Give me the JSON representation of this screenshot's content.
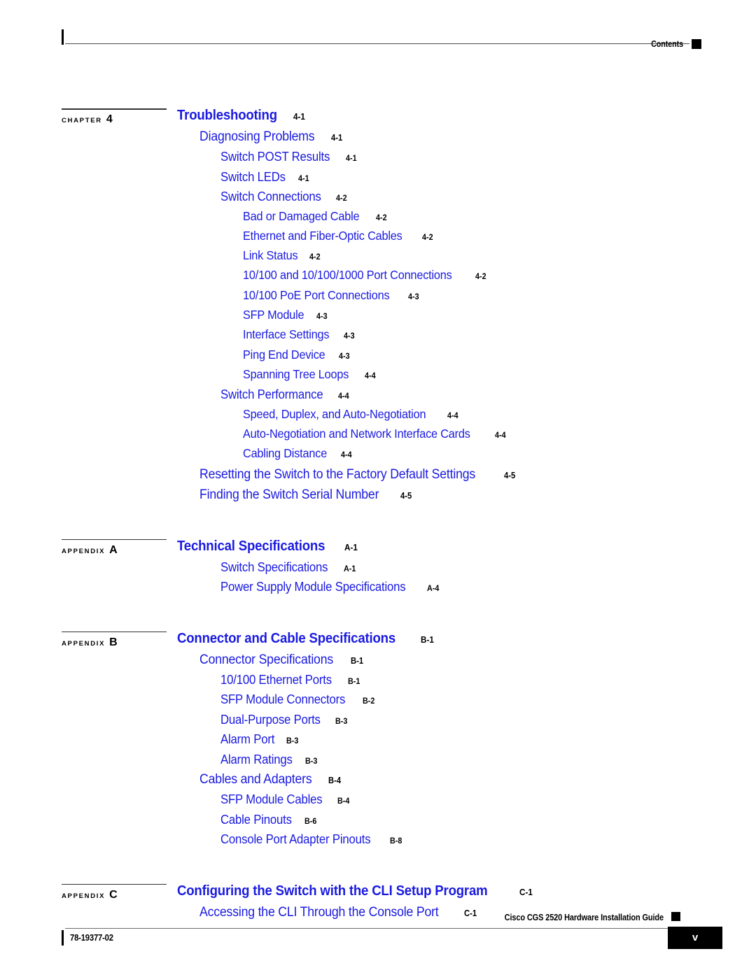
{
  "header": {
    "label": "Contents",
    "marker_icon": "black-square-marker"
  },
  "footer": {
    "guide_title": "Cisco CGS 2520 Hardware Installation Guide",
    "doc_number": "78-19377-02",
    "page_number": "v",
    "marker_icon": "black-square-marker"
  },
  "colors": {
    "entry_link": "#1a1ae0",
    "page_number": "#000000",
    "rule": "#4d4d4d"
  },
  "groups": [
    {
      "marker_word": "CHAPTER",
      "marker_num": "4",
      "entries": [
        {
          "level": 0,
          "title": "Troubleshooting",
          "page": "4-1"
        },
        {
          "level": 1,
          "title": "Diagnosing Problems",
          "page": "4-1"
        },
        {
          "level": 2,
          "title": "Switch POST Results",
          "page": "4-1"
        },
        {
          "level": 2,
          "title": "Switch LEDs",
          "page": "4-1"
        },
        {
          "level": 2,
          "title": "Switch Connections",
          "page": "4-2"
        },
        {
          "level": 3,
          "title": "Bad or Damaged Cable",
          "page": "4-2"
        },
        {
          "level": 3,
          "title": "Ethernet and Fiber-Optic Cables",
          "page": "4-2"
        },
        {
          "level": 3,
          "title": "Link Status",
          "page": "4-2"
        },
        {
          "level": 3,
          "title": "10/100 and 10/100/1000 Port Connections",
          "page": "4-2"
        },
        {
          "level": 3,
          "title": "10/100 PoE Port Connections",
          "page": "4-3"
        },
        {
          "level": 3,
          "title": "SFP Module",
          "page": "4-3"
        },
        {
          "level": 3,
          "title": "Interface Settings",
          "page": "4-3"
        },
        {
          "level": 3,
          "title": "Ping End Device",
          "page": "4-3"
        },
        {
          "level": 3,
          "title": "Spanning Tree Loops",
          "page": "4-4"
        },
        {
          "level": 2,
          "title": "Switch Performance",
          "page": "4-4"
        },
        {
          "level": 3,
          "title": "Speed, Duplex, and Auto-Negotiation",
          "page": "4-4"
        },
        {
          "level": 3,
          "title": "Auto-Negotiation and Network Interface Cards",
          "page": "4-4"
        },
        {
          "level": 3,
          "title": "Cabling Distance",
          "page": "4-4"
        },
        {
          "level": 1,
          "title": "Resetting the Switch to the Factory Default Settings",
          "page": "4-5"
        },
        {
          "level": 1,
          "title": "Finding the Switch Serial Number",
          "page": "4-5"
        }
      ]
    },
    {
      "marker_word": "APPENDIX",
      "marker_num": "A",
      "entries": [
        {
          "level": 0,
          "title": "Technical Specifications",
          "page": "A-1"
        },
        {
          "level": 2,
          "title": "Switch Specifications",
          "page": "A-1"
        },
        {
          "level": 2,
          "title": "Power Supply Module Specifications",
          "page": "A-4"
        }
      ]
    },
    {
      "marker_word": "APPENDIX",
      "marker_num": "B",
      "entries": [
        {
          "level": 0,
          "title": "Connector and Cable Specifications",
          "page": "B-1"
        },
        {
          "level": 1,
          "title": "Connector Specifications",
          "page": "B-1"
        },
        {
          "level": 2,
          "title": "10/100 Ethernet Ports",
          "page": "B-1"
        },
        {
          "level": 2,
          "title": "SFP Module Connectors",
          "page": "B-2"
        },
        {
          "level": 2,
          "title": "Dual-Purpose Ports",
          "page": "B-3"
        },
        {
          "level": 2,
          "title": "Alarm Port",
          "page": "B-3"
        },
        {
          "level": 2,
          "title": "Alarm Ratings",
          "page": "B-3"
        },
        {
          "level": 1,
          "title": "Cables and Adapters",
          "page": "B-4"
        },
        {
          "level": 2,
          "title": "SFP Module Cables",
          "page": "B-4"
        },
        {
          "level": 2,
          "title": "Cable Pinouts",
          "page": "B-6"
        },
        {
          "level": 2,
          "title": "Console Port Adapter Pinouts",
          "page": "B-8"
        }
      ]
    },
    {
      "marker_word": "APPENDIX",
      "marker_num": "C",
      "entries": [
        {
          "level": 0,
          "title": "Configuring the Switch with the CLI Setup Program",
          "page": "C-1"
        },
        {
          "level": 1,
          "title": "Accessing the CLI Through the Console Port",
          "page": "C-1"
        }
      ]
    }
  ]
}
